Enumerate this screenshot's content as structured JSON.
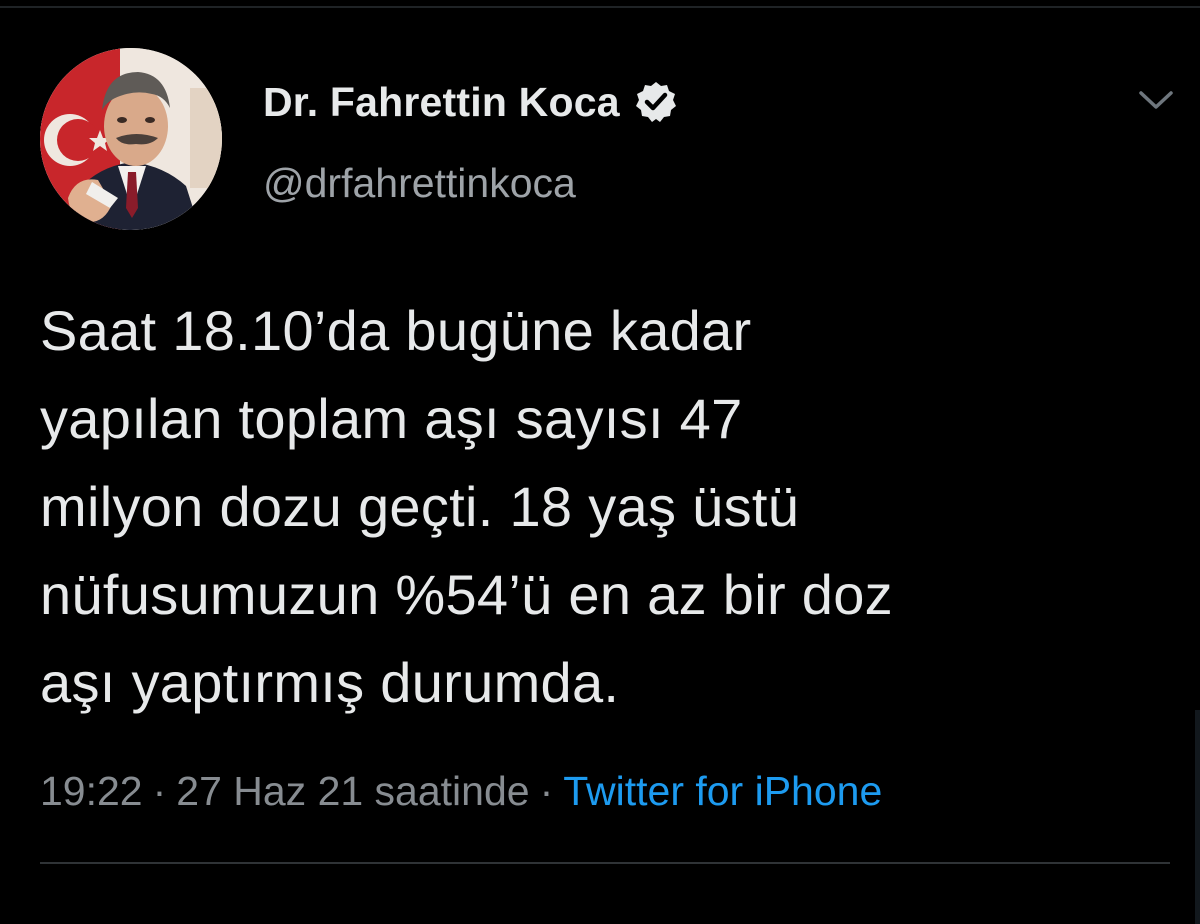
{
  "tweet": {
    "author": {
      "display_name": "Dr. Fahrettin Koca",
      "handle": "@drfahrettinkoca",
      "verified": true
    },
    "text_lines": [
      "Saat 18.10’da bugüne kadar",
      "yapılan toplam aşı sayısı 47",
      "milyon dozu geçti. 18 yaş üstü",
      "nüfusumuzun %54’ü en az bir doz",
      "aşı yaptırmış durumda."
    ],
    "meta": {
      "time": "19:22",
      "separator": "·",
      "date": "27 Haz 21 saatinde",
      "source": "Twitter for iPhone"
    },
    "icons": {
      "verified": "verified-badge-icon",
      "more": "chevron-down-icon"
    }
  },
  "colors": {
    "background": "#000000",
    "text": "#e7e9ea",
    "secondary": "#878c91",
    "link": "#1d9bf0"
  }
}
